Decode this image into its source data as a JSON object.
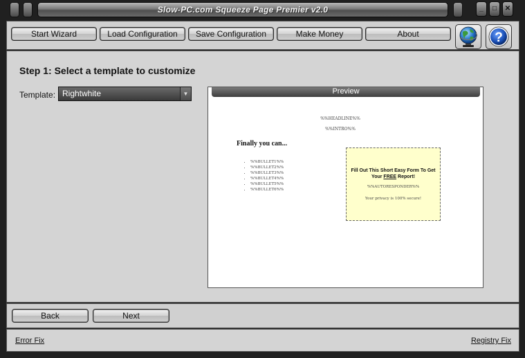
{
  "window": {
    "title": "Slow-PC.com Squeeze Page Premier v2.0",
    "controls": {
      "minimize": "_",
      "restore": "□",
      "close": "✕"
    }
  },
  "toolbar": {
    "buttons": [
      {
        "label": "Start Wizard"
      },
      {
        "label": "Load Configuration"
      },
      {
        "label": "Save Configuration"
      },
      {
        "label": "Make Money"
      },
      {
        "label": "About"
      }
    ],
    "icons": [
      "globe-icon",
      "help-icon"
    ],
    "help_glyph": "?"
  },
  "step": {
    "title": "Step 1: Select a template to customize",
    "template_label": "Template:",
    "template_value": "Rightwhite"
  },
  "preview": {
    "header": "Preview",
    "headline": "%%HEADLINE%%",
    "intro": "%%INTRO%%",
    "heading": "Finally you can...",
    "bullets": [
      "%%BULLET1%%",
      "%%BULLET2%%",
      "%%BULLET3%%",
      "%%BULLET4%%",
      "%%BULLET5%%",
      "%%BULLET6%%"
    ],
    "form_title_pre": "Fill Out This Short Easy Form To Get Your ",
    "form_title_free": "FREE",
    "form_title_post": " Report!",
    "form_autoresponder": "%%AUTORESPONDER%%",
    "form_privacy": "Your privacy is 100% secure!"
  },
  "nav": {
    "back": "Back",
    "next": "Next"
  },
  "footer": {
    "error_fix": "Error Fix",
    "registry_fix": "Registry Fix"
  },
  "colors": {
    "panel": "#d4d4d4",
    "frame": "#202020",
    "form_bg": "#ffffcc",
    "help_blue": "#1a4fb5"
  }
}
